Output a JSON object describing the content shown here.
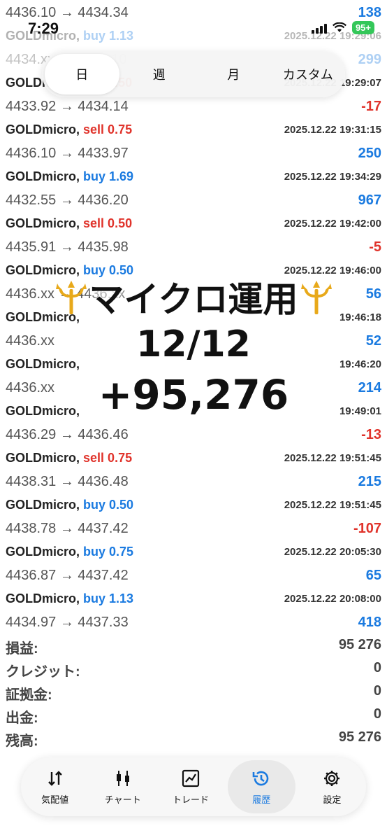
{
  "status": {
    "time": "7:29",
    "battery": "95+"
  },
  "segments": [
    "日",
    "週",
    "月",
    "カスタム"
  ],
  "trades": [
    {
      "price": "4436.10 → 4434.34",
      "pl": "138",
      "dir": "pos",
      "top": 0,
      "faded": false,
      "nosym": true
    },
    {
      "symbol": "GOLDmicro,",
      "side": "buy",
      "volume": "buy 1.13",
      "datetime": "2025.12.22 19:29:06",
      "price": "4434.xx → 4430.10",
      "pl": "299",
      "dir": "pos",
      "faded": true
    },
    {
      "symbol": "GOLDmicro,",
      "side": "sell",
      "volume": "sell 0.50",
      "datetime": "2025.12.22 19:29:07",
      "price": "4433.92 → 4434.14",
      "pl": "-17",
      "dir": "neg",
      "faded": false
    },
    {
      "symbol": "GOLDmicro,",
      "side": "sell",
      "volume": "sell 0.75",
      "datetime": "2025.12.22 19:31:15",
      "price": "4436.10 → 4433.97",
      "pl": "250",
      "dir": "pos"
    },
    {
      "symbol": "GOLDmicro,",
      "side": "buy",
      "volume": "buy 1.69",
      "datetime": "2025.12.22 19:34:29",
      "price": "4432.55 → 4436.20",
      "pl": "967",
      "dir": "pos"
    },
    {
      "symbol": "GOLDmicro,",
      "side": "sell",
      "volume": "sell 0.50",
      "datetime": "2025.12.22 19:42:00",
      "price": "4435.91 → 4435.98",
      "pl": "-5",
      "dir": "neg"
    },
    {
      "symbol": "GOLDmicro,",
      "side": "buy",
      "volume": "buy 0.50",
      "datetime": "2025.12.22 19:46:00",
      "price": "4436.xx → 4436.xx",
      "pl": "56",
      "dir": "pos"
    },
    {
      "symbol": "GOLDmicro,",
      "side": "buy",
      "volume": "",
      "datetime": "19:46:18",
      "price": "4436.xx",
      "pl": "52",
      "dir": "pos"
    },
    {
      "symbol": "GOLDmicro,",
      "side": "buy",
      "volume": "",
      "datetime": "19:46:20",
      "price": "4436.xx",
      "pl": "214",
      "dir": "pos"
    },
    {
      "symbol": "GOLDmicro,",
      "side": "buy",
      "volume": "",
      "datetime": "19:49:01",
      "price": "4436.29 → 4436.46",
      "pl": "-13",
      "dir": "neg"
    },
    {
      "symbol": "GOLDmicro,",
      "side": "sell",
      "volume": "sell 0.75",
      "datetime": "2025.12.22 19:51:45",
      "price": "4438.31 → 4436.48",
      "pl": "215",
      "dir": "pos"
    },
    {
      "symbol": "GOLDmicro,",
      "side": "buy",
      "volume": "buy 0.50",
      "datetime": "2025.12.22 19:51:45",
      "price": "4438.78 → 4437.42",
      "pl": "-107",
      "dir": "neg"
    },
    {
      "symbol": "GOLDmicro,",
      "side": "buy",
      "volume": "buy 0.75",
      "datetime": "2025.12.22 20:05:30",
      "price": "4436.87 → 4437.42",
      "pl": "65",
      "dir": "pos"
    },
    {
      "symbol": "GOLDmicro,",
      "side": "buy",
      "volume": "buy 1.13",
      "datetime": "2025.12.22 20:08:00",
      "price": "4434.97 → 4437.33",
      "pl": "418",
      "dir": "pos"
    }
  ],
  "overlay": {
    "line1": "マイクロ運用",
    "line2": "12/12",
    "line3": "+95,276"
  },
  "summary": [
    {
      "key": "損益:",
      "value": "95 276"
    },
    {
      "key": "クレジット:",
      "value": "0"
    },
    {
      "key": "証拠金:",
      "value": "0"
    },
    {
      "key": "出金:",
      "value": "0"
    },
    {
      "key": "残高:",
      "value": "95 276"
    }
  ],
  "tabs": [
    {
      "label": "気配値",
      "icon": "quotes-icon"
    },
    {
      "label": "チャート",
      "icon": "chart-icon"
    },
    {
      "label": "トレード",
      "icon": "trade-icon"
    },
    {
      "label": "履歴",
      "icon": "history-icon",
      "active": true
    },
    {
      "label": "設定",
      "icon": "settings-icon"
    }
  ]
}
